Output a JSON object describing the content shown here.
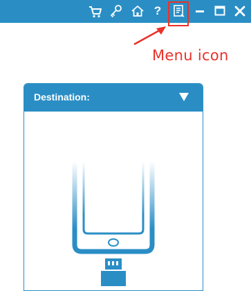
{
  "titlebar": {
    "background": "#2a8ec5",
    "icons": [
      "cart-icon",
      "key-icon",
      "home-icon",
      "help-icon",
      "menu-icon",
      "minimize-icon",
      "maximize-icon",
      "close-icon"
    ],
    "help_label": "?"
  },
  "annotation": {
    "label": "Menu icon",
    "color": "#e8322a"
  },
  "destination": {
    "title": "Destination:",
    "accent": "#2a8ec5"
  }
}
